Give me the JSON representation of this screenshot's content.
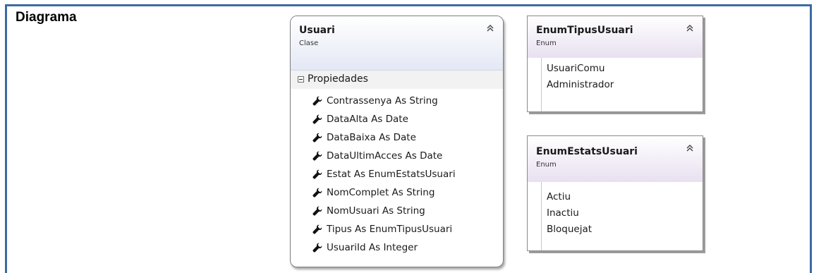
{
  "section": {
    "title": "Diagrama"
  },
  "colors": {
    "frame": "#3e6aa3",
    "class_header": "#e4e8f5",
    "enum_header": "#e8e0f0"
  },
  "usuari": {
    "name": "Usuari",
    "kind": "Clase",
    "compartment": "Propiedades",
    "properties": [
      "Contrassenya As String",
      "DataAlta As Date",
      "DataBaixa As Date",
      "DataUltimAcces As Date",
      "Estat As EnumEstatsUsuari",
      "NomComplet As String",
      "NomUsuari As String",
      "Tipus As EnumTipusUsuari",
      "UsuariId As Integer"
    ]
  },
  "enum_tipus": {
    "name": "EnumTipusUsuari",
    "kind": "Enum",
    "values": [
      "UsuariComu",
      "Administrador"
    ]
  },
  "enum_estats": {
    "name": "EnumEstatsUsuari",
    "kind": "Enum",
    "values": [
      "Actiu",
      "Inactiu",
      "Bloquejat"
    ]
  }
}
